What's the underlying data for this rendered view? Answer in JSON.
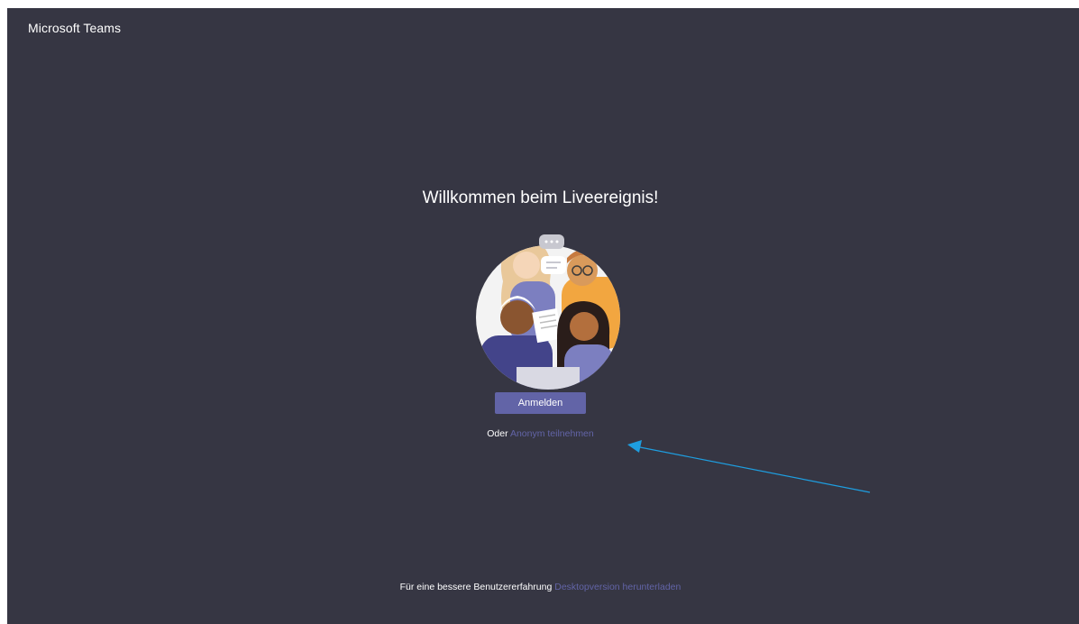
{
  "app": {
    "title": "Microsoft Teams"
  },
  "main": {
    "welcome_heading": "Willkommen beim Liveereignis!",
    "signin_label": "Anmelden",
    "anon_prefix": "Oder",
    "anon_link": "Anonym teilnehmen"
  },
  "footer": {
    "text": "Für eine bessere Benutzererfahrung",
    "link": "Desktopversion herunterladen"
  },
  "colors": {
    "background": "#363643",
    "brand": "#6264a7",
    "annotation_arrow": "#1e9ee0"
  }
}
